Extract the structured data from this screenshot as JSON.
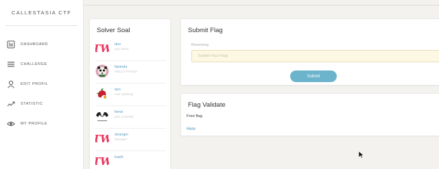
{
  "brand": "CALLESTASIA CTF",
  "nav": [
    {
      "label": "DASHBOARD",
      "icon": "dashboard-icon"
    },
    {
      "label": "CHALLENGE",
      "icon": "menu-icon"
    },
    {
      "label": "EDIT PROFIL",
      "icon": "user-icon"
    },
    {
      "label": "STATISTIC",
      "icon": "trend-icon"
    },
    {
      "label": "MY PROFILE",
      "icon": "eye-icon"
    }
  ],
  "solver": {
    "title": "Solver Soal",
    "items": [
      {
        "name": "duo",
        "sub": "duo ewes",
        "avatar": "twice-logo-avatar"
      },
      {
        "name": "hpanda",
        "sub": "HELLO PANDA",
        "avatar": "panda-avatar"
      },
      {
        "name": "ayo",
        "sub": "Ave ngoleng",
        "avatar": "chili-avatar"
      },
      {
        "name": "fiend",
        "sub": "just_m1en6k",
        "avatar": "hands-avatar"
      },
      {
        "name": "stranger",
        "sub": "Stranger",
        "avatar": "twice-logo-avatar"
      },
      {
        "name": "kasih",
        "sub": "",
        "avatar": "twice-logo-avatar"
      }
    ]
  },
  "submit_flag": {
    "title": "Submit Flag",
    "category": "Reversing",
    "input_placeholder": "Submit Your Flag!",
    "button_label": "Submit"
  },
  "flag_validate": {
    "title": "Flag Validate",
    "text": "Free flag",
    "link": "Here"
  },
  "colors": {
    "accent": "#6cb4cc",
    "link": "#4a90b8",
    "twice": "#e8335a"
  }
}
